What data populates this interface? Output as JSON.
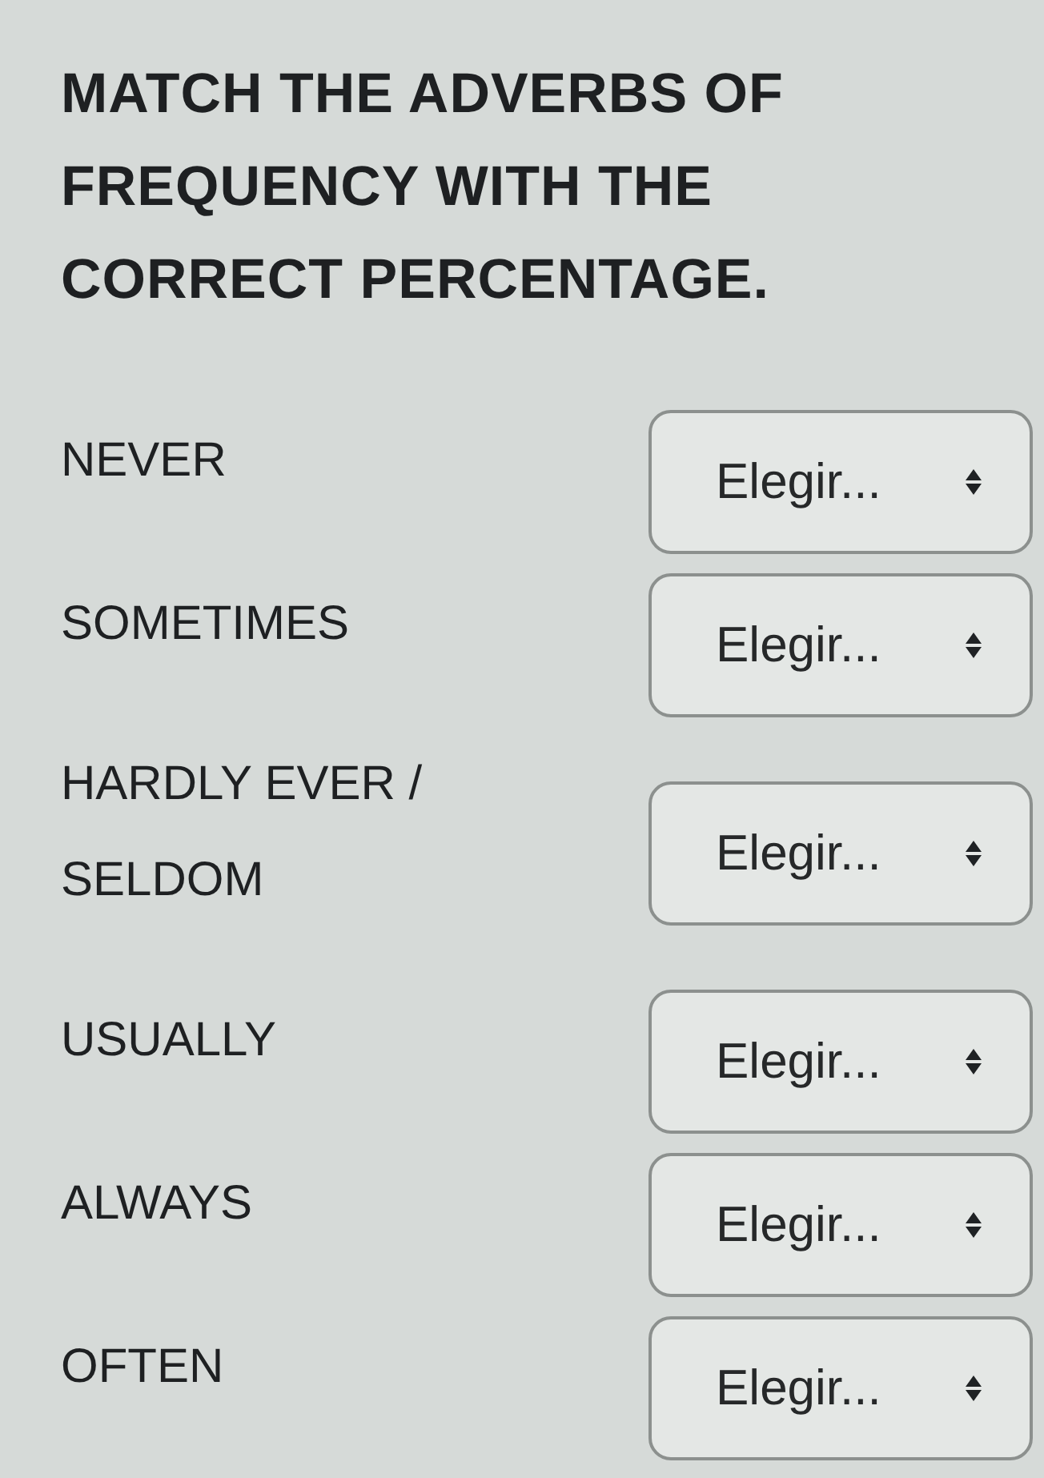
{
  "title": "MATCH THE ADVERBS OF FREQUENCY WITH THE CORRECT PERCENTAGE.",
  "rows": [
    {
      "label": "NEVER",
      "dropdown": {
        "placeholder": "Elegir..."
      }
    },
    {
      "label": "SOMETIMES",
      "dropdown": {
        "placeholder": "Elegir..."
      }
    },
    {
      "label": "HARDLY EVER / SELDOM",
      "dropdown": {
        "placeholder": "Elegir..."
      }
    },
    {
      "label": "USUALLY",
      "dropdown": {
        "placeholder": "Elegir..."
      }
    },
    {
      "label": "ALWAYS",
      "dropdown": {
        "placeholder": "Elegir..."
      }
    },
    {
      "label": "OFTEN",
      "dropdown": {
        "placeholder": "Elegir..."
      }
    }
  ]
}
